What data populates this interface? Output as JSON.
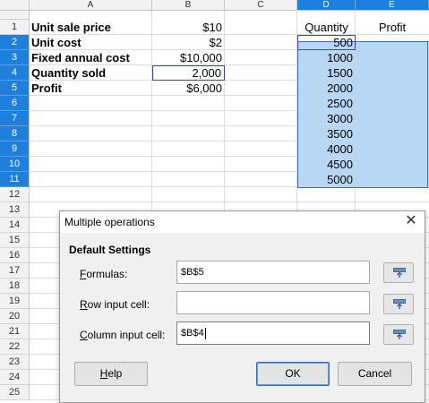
{
  "sheet": {
    "columns": [
      "A",
      "B",
      "C",
      "D",
      "E"
    ],
    "rows": [
      "1",
      "2",
      "3",
      "4",
      "5",
      "6",
      "7",
      "8",
      "9",
      "10",
      "11",
      "12",
      "13",
      "14",
      "15",
      "16",
      "17",
      "18",
      "19",
      "20",
      "21",
      "22",
      "23",
      "24",
      "25"
    ],
    "col_a": [
      "Unit sale price",
      "Unit cost",
      "Fixed annual cost",
      "Quantity sold",
      "Profit"
    ],
    "col_b": [
      "$10",
      "$2",
      "$10,000",
      "2,000",
      "$6,000"
    ],
    "d_header": "Quantity",
    "e_header": "Profit",
    "col_d": [
      "500",
      "1000",
      "1500",
      "2000",
      "2500",
      "3000",
      "3500",
      "4000",
      "4500",
      "5000"
    ],
    "selection_color": "#b7d7f2",
    "header_selected_color": "#1f7fdc"
  },
  "dialog": {
    "title": "Multiple operations",
    "close_glyph": "✕",
    "section": "Default Settings",
    "formulas": {
      "label_accel": "F",
      "label_rest": "ormulas:",
      "value": "$B$5"
    },
    "row_input": {
      "label_accel": "R",
      "label_rest": "ow input cell:",
      "value": ""
    },
    "column_input": {
      "label_accel": "C",
      "label_rest": "olumn input cell:",
      "value": "$B$4"
    },
    "buttons": {
      "help": {
        "accel": "H",
        "rest": "elp"
      },
      "ok": "OK",
      "cancel": "Cancel"
    }
  }
}
